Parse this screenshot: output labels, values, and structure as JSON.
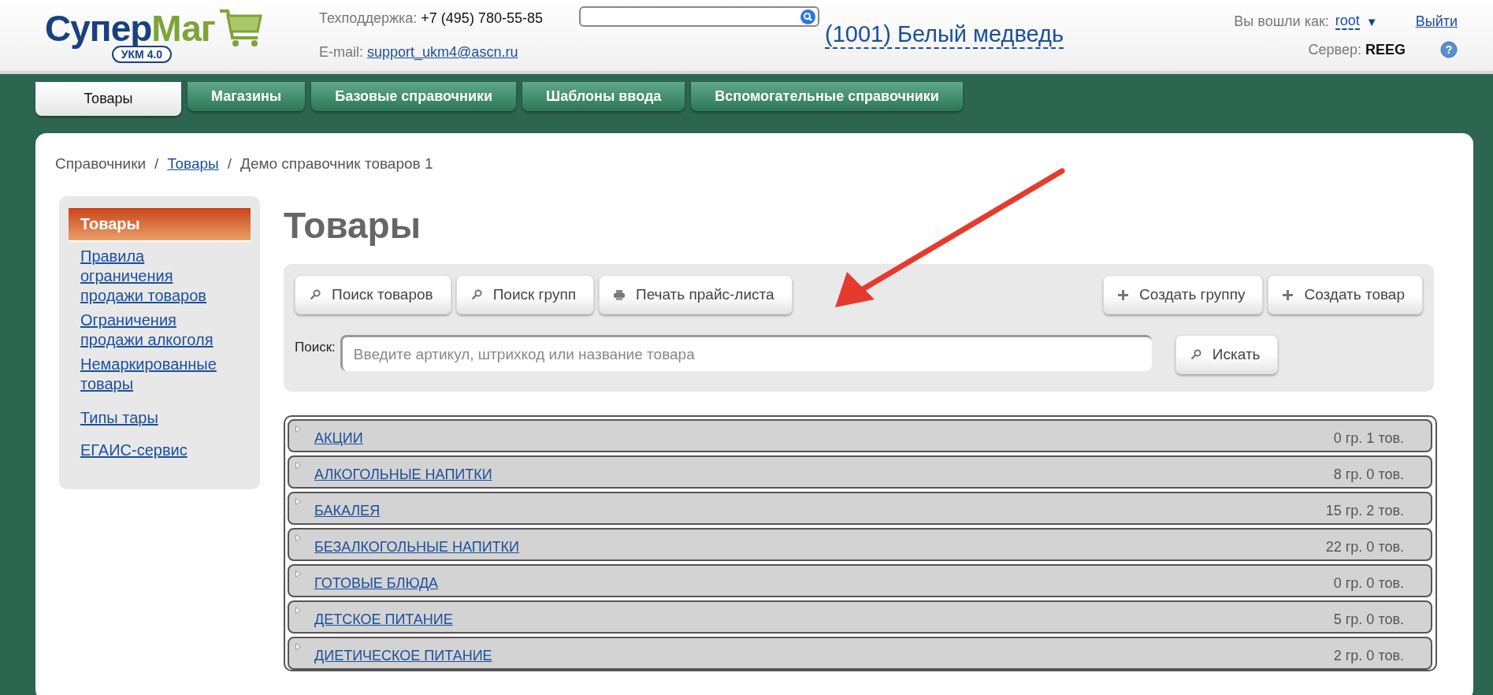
{
  "header": {
    "logo": {
      "part1": "Супер",
      "part2": "Маг",
      "version": "УКМ 4.0"
    },
    "support": {
      "label": "Техподдержка:",
      "phone": "+7 (495) 780-55-85"
    },
    "email": {
      "label": "E-mail:",
      "address": "support_ukm4@ascn.ru"
    },
    "store": "(1001) Белый медведь",
    "user": {
      "label": "Вы вошли как:",
      "name": "root",
      "caret": "▼"
    },
    "logout": "Выйти",
    "server": {
      "label": "Сервер:",
      "name": "REEG"
    },
    "help_icon": "?"
  },
  "nav_tabs": [
    {
      "label": "Товары",
      "selected": true
    },
    {
      "label": "Магазины",
      "selected": false
    },
    {
      "label": "Базовые справочники",
      "selected": false
    },
    {
      "label": "Шаблоны ввода",
      "selected": false
    },
    {
      "label": "Вспомогательные справочники",
      "selected": false
    }
  ],
  "breadcrumb": [
    {
      "label": "Справочники",
      "kind": "text"
    },
    {
      "label": "/",
      "kind": "separator"
    },
    {
      "label": "Товары",
      "kind": "link"
    },
    {
      "label": "/",
      "kind": "separator"
    },
    {
      "label": "Демо справочник товаров 1",
      "kind": "text"
    }
  ],
  "sidebar": {
    "items": [
      {
        "label": "Товары",
        "selected": true
      },
      {
        "label": "Правила ограничения продажи товаров",
        "selected": false
      },
      {
        "label": "Ограничения продажи алкоголя",
        "selected": false
      },
      {
        "label": "Немаркированные товары",
        "selected": false
      },
      {
        "label": "Типы тары",
        "selected": false
      },
      {
        "label": "ЕГАИС-сервис",
        "selected": false
      }
    ]
  },
  "page_title": "Товары",
  "toolbar": {
    "left_buttons": [
      {
        "label": "Поиск товаров",
        "kind": "search"
      },
      {
        "label": "Поиск групп",
        "kind": "search"
      },
      {
        "label": "Печать прайс-листа",
        "kind": "print"
      }
    ],
    "right_buttons": [
      {
        "label": "Создать группу",
        "kind": "plus"
      },
      {
        "label": "Создать товар",
        "kind": "plus"
      }
    ],
    "search": {
      "label": "Поиск:",
      "placeholder": "Введите артикул, штрихкод или название товара",
      "button": "Искать"
    }
  },
  "groups": [
    {
      "name": "АКЦИИ",
      "count": "0 гр. 1 тов."
    },
    {
      "name": "АЛКОГОЛЬНЫЕ НАПИТКИ",
      "count": "8 гр. 0 тов."
    },
    {
      "name": "БАКАЛЕЯ",
      "count": "15 гр. 2 тов."
    },
    {
      "name": "БЕЗАЛКОГОЛЬНЫЕ НАПИТКИ",
      "count": "22 гр. 0 тов."
    },
    {
      "name": "ГОТОВЫЕ БЛЮДА",
      "count": "0 гр. 0 тов."
    },
    {
      "name": "ДЕТСКОЕ ПИТАНИЕ",
      "count": "5 гр. 0 тов."
    },
    {
      "name": "ДИЕТИЧЕСКОЕ ПИТАНИЕ",
      "count": "2 гр. 0 тов."
    }
  ]
}
